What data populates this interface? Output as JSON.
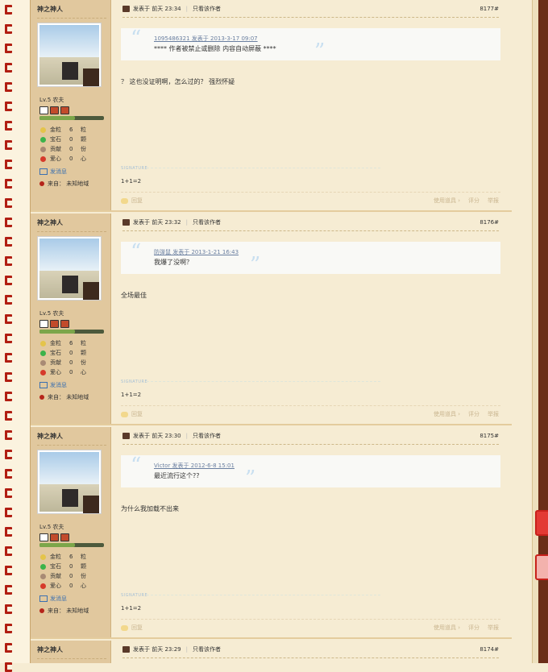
{
  "posts": [
    {
      "username": "神之神人",
      "level": "Lv.5 农夫",
      "level_progress": 0.55,
      "stats": [
        {
          "label": "金粒",
          "value": "6",
          "unit": "粒",
          "color": "#e4c44a"
        },
        {
          "label": "宝石",
          "value": "0",
          "unit": "颗",
          "color": "#3cb34a"
        },
        {
          "label": "贡献",
          "value": "0",
          "unit": "份",
          "color": "#a88a74"
        },
        {
          "label": "爱心",
          "value": "0",
          "unit": "心",
          "color": "#d63a2b"
        }
      ],
      "send_message": "发消息",
      "location": "来自：  未知地域",
      "posted": "发表于 前天 23:34",
      "only_author": "只看该作者",
      "floor": "8177#",
      "quote_header": "1095486321 发表于 2013-3-17 09:07",
      "quote_body": "**** 作者被禁止或删除 内容自动屏蔽 ****",
      "body": "？ 这也没证明啊，怎么过的？ 强烈怀疑",
      "signature_label": "SIGNATURE",
      "signature": "1+1=2",
      "reply": "回复",
      "actions": [
        "使用道具 ›",
        "评分",
        "举报"
      ]
    },
    {
      "username": "神之神人",
      "level": "Lv.5 农夫",
      "level_progress": 0.55,
      "stats": [
        {
          "label": "金粒",
          "value": "6",
          "unit": "粒",
          "color": "#e4c44a"
        },
        {
          "label": "宝石",
          "value": "0",
          "unit": "颗",
          "color": "#3cb34a"
        },
        {
          "label": "贡献",
          "value": "0",
          "unit": "份",
          "color": "#a88a74"
        },
        {
          "label": "爱心",
          "value": "0",
          "unit": "心",
          "color": "#d63a2b"
        }
      ],
      "send_message": "发消息",
      "location": "来自：  未知地域",
      "posted": "发表于 前天 23:32",
      "only_author": "只看该作者",
      "floor": "8176#",
      "quote_header": "防弹鼠 发表于 2013-1-21 16:43",
      "quote_body": "我爆了没啊？",
      "body": "全场最佳",
      "signature_label": "SIGNATURE",
      "signature": "1+1=2",
      "reply": "回复",
      "actions": [
        "使用道具 ›",
        "评分",
        "举报"
      ]
    },
    {
      "username": "神之神人",
      "level": "Lv.5 农夫",
      "level_progress": 0.55,
      "stats": [
        {
          "label": "金粒",
          "value": "6",
          "unit": "粒",
          "color": "#e4c44a"
        },
        {
          "label": "宝石",
          "value": "0",
          "unit": "颗",
          "color": "#3cb34a"
        },
        {
          "label": "贡献",
          "value": "0",
          "unit": "份",
          "color": "#a88a74"
        },
        {
          "label": "爱心",
          "value": "0",
          "unit": "心",
          "color": "#d63a2b"
        }
      ],
      "send_message": "发消息",
      "location": "来自：  未知地域",
      "posted": "发表于 前天 23:30",
      "only_author": "只看该作者",
      "floor": "8175#",
      "quote_header": "Victor 发表于 2012-6-8 15:01",
      "quote_body": "最近流行这个??",
      "body": "为什么我加载不出来",
      "signature_label": "SIGNATURE",
      "signature": "1+1=2",
      "reply": "回复",
      "actions": [
        "使用道具 ›",
        "评分",
        "举报"
      ]
    }
  ],
  "next_post": {
    "username": "神之神人",
    "posted": "发表于 前天 23:29",
    "only_author": "只看该作者",
    "floor": "8174#"
  }
}
